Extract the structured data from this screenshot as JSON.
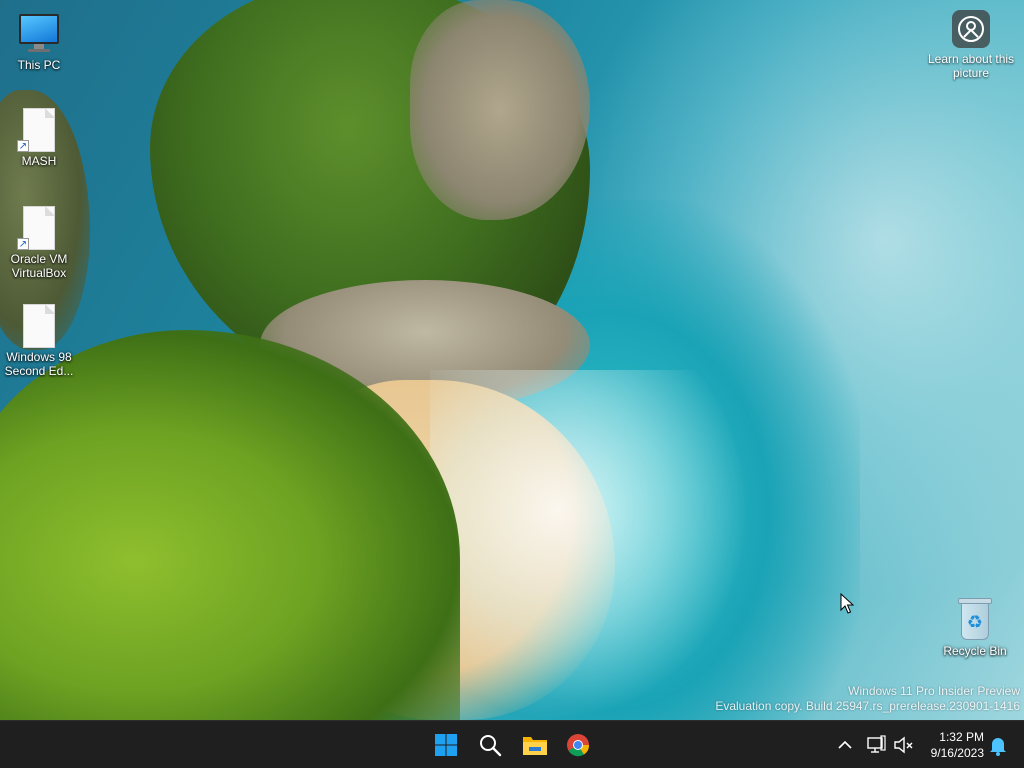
{
  "desktop": {
    "icons": [
      {
        "label": "This PC",
        "type": "computer",
        "icon": "monitor-icon"
      },
      {
        "label": "MASH",
        "type": "shortcut",
        "icon": "document-icon"
      },
      {
        "label": "Oracle VM VirtualBox",
        "type": "shortcut",
        "icon": "document-icon"
      },
      {
        "label": "Windows 98 Second Ed...",
        "type": "file",
        "icon": "document-icon"
      },
      {
        "label": "Recycle Bin",
        "type": "recycle-bin",
        "icon": "recycle-bin-icon"
      }
    ],
    "learn_about": {
      "label": "Learn about this picture",
      "icon": "camera-location-icon"
    },
    "watermark": {
      "line1": "Windows 11 Pro Insider Preview",
      "line2": "Evaluation copy. Build 25947.rs_prerelease.230901-1416"
    }
  },
  "taskbar": {
    "apps": [
      {
        "name": "Start",
        "icon": "windows-start-icon"
      },
      {
        "name": "Search",
        "icon": "search-icon"
      },
      {
        "name": "File Explorer",
        "icon": "folder-icon"
      },
      {
        "name": "Google Chrome",
        "icon": "chrome-icon"
      }
    ],
    "tray": {
      "time": "1:32 PM",
      "date": "9/16/2023",
      "icons": [
        "chevron-up-icon",
        "network-icon",
        "volume-muted-icon",
        "notification-bell-icon"
      ]
    },
    "colors": {
      "background": "#1f1f1f",
      "accent": "#0078d4"
    }
  }
}
